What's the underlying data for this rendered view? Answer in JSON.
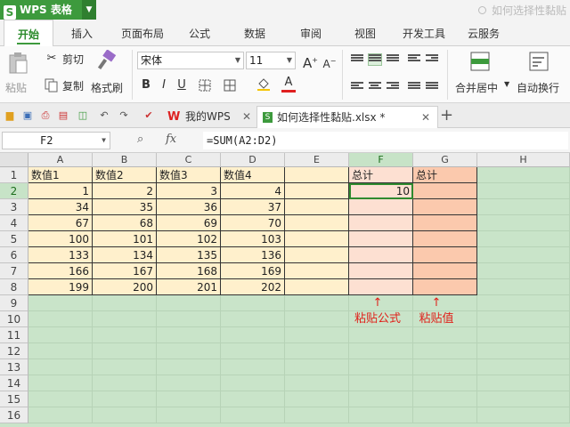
{
  "app": {
    "name": "WPS 表格"
  },
  "help_search": "如何选择性黏贴",
  "menu": [
    "开始",
    "插入",
    "页面布局",
    "公式",
    "数据",
    "审阅",
    "视图",
    "开发工具",
    "云服务"
  ],
  "ribbon": {
    "paste": "粘贴",
    "cut": "剪切",
    "copy": "复制",
    "format_painter": "格式刷",
    "font": "宋体",
    "font_size": "11",
    "merge": "合并居中",
    "wrap": "自动换行"
  },
  "tabs": {
    "home": "我的WPS",
    "file": "如何选择性黏贴.xlsx *"
  },
  "formula_bar": {
    "name_box": "F2",
    "fx": "fx",
    "formula": "=SUM(A2:D2)"
  },
  "sheet": {
    "columns": [
      "A",
      "B",
      "C",
      "D",
      "E",
      "F",
      "G",
      "H"
    ],
    "rows": [
      "1",
      "2",
      "3",
      "4",
      "5",
      "6",
      "7",
      "8",
      "9",
      "10",
      "11",
      "12",
      "13",
      "14",
      "15",
      "16"
    ],
    "headers": [
      "数值1",
      "数值2",
      "数值3",
      "数值4"
    ],
    "data": [
      [
        1,
        2,
        3,
        4
      ],
      [
        34,
        35,
        36,
        37
      ],
      [
        67,
        68,
        69,
        70
      ],
      [
        100,
        101,
        102,
        103
      ],
      [
        133,
        134,
        135,
        136
      ],
      [
        166,
        167,
        168,
        169
      ],
      [
        199,
        200,
        201,
        202
      ]
    ],
    "total_header_f": "总计",
    "total_header_g": "总计",
    "f2_value": "10"
  },
  "annotations": {
    "paste_formula": "粘贴公式",
    "paste_value": "粘贴值",
    "arrow": "↑"
  },
  "colors": {
    "accent": "#3d9a3d",
    "data_fill": "#fff0cc",
    "f_fill": "#fde0d2",
    "g_fill": "#fbc9ad",
    "annotation": "#e0201a"
  }
}
